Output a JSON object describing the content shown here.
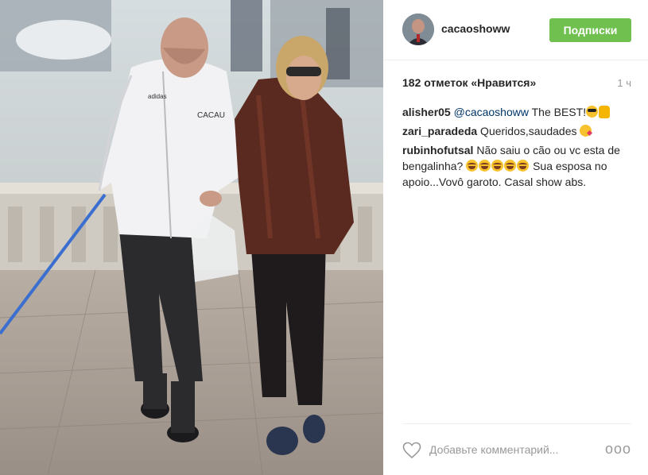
{
  "post": {
    "username": "cacaoshoww",
    "follow_label": "Подписки",
    "likes_text": "182 отметок «Нравится»",
    "time_ago": "1 ч",
    "photo_jacket_text": "CACAU",
    "photo_brand_text": "adidas",
    "comments": [
      {
        "user": "alisher05",
        "mention": "@cacaoshoww",
        "text": " The BEST!"
      },
      {
        "user": "zari_paradeda",
        "text": " Queridos,saudades "
      },
      {
        "user": "rubinhofutsal",
        "text": " Não saiu o cão ou vc esta de bengalinha? ",
        "text_after": " Sua esposa no apoio...Vovô garoto. Casal show abs."
      }
    ],
    "comment_placeholder": "Добавьте комментарий...",
    "more_label": "ooo"
  },
  "colors": {
    "follow_button": "#70c050",
    "mention": "#003569",
    "muted": "#999999"
  },
  "icons": {
    "heart": "heart-outline-icon",
    "more": "more-options-icon"
  }
}
